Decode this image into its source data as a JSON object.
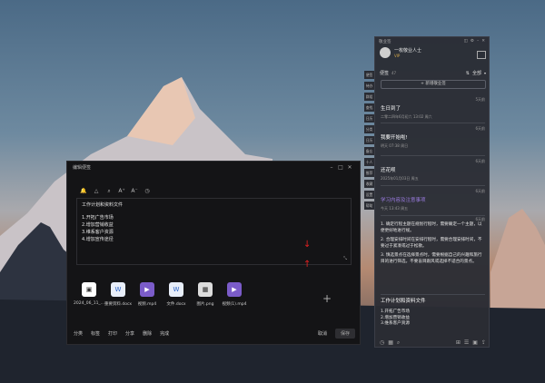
{
  "editor": {
    "title": "编辑便签",
    "toolbar_icons": [
      "bell-icon",
      "triangle-icon",
      "search-icon",
      "font-bigger-icon",
      "font-smaller-icon",
      "clock-icon"
    ],
    "content_lines": [
      "工作计划和资料文件",
      "1.开拓广告市场",
      "2.增加营销收益",
      "3.维系客户资源",
      "4.增加宣传途径"
    ],
    "attachments": [
      {
        "name": "2024_06_11_...",
        "type": "file",
        "icon": "file-icon"
      },
      {
        "name": "重要资料.docx",
        "type": "word",
        "icon": "word-icon"
      },
      {
        "name": "视频.mp4",
        "type": "video",
        "icon": "video-icon"
      },
      {
        "name": "文件.docx",
        "type": "word",
        "icon": "word-icon"
      },
      {
        "name": "图片.png",
        "type": "img",
        "icon": "image-icon"
      },
      {
        "name": "视频(1).mp4",
        "type": "video",
        "icon": "video-icon"
      }
    ],
    "bottom_actions": [
      "分类",
      "标签",
      "打印",
      "分享",
      "删除",
      "完成"
    ],
    "cancel_label": "取消",
    "save_label": "保存"
  },
  "panel": {
    "title": "敬业签",
    "username": "一枚敬业人士",
    "vip": "VIP",
    "tab": "便签",
    "tab_count": "47",
    "filter": "全部",
    "new_label": "+ 新增敬业签",
    "notes": [
      {
        "ago": "5天前",
        "title": "生日到了",
        "date": "二零二四年6月初六 13:02 周六"
      },
      {
        "ago": "6天前",
        "title": "我要开始啦!",
        "date": "明天 07:38 周日"
      },
      {
        "ago": "6天前",
        "title": "还花呗",
        "date": "2025年01月03日 周五"
      },
      {
        "ago": "6天前",
        "title": "学习内容及注意事项",
        "date": "今天 13:43 周五"
      }
    ],
    "long_note": {
      "ago": "6天前",
      "paragraphs": [
        "1. 确定行程主题在规划行程时，需要确定一个主题，以便更好地进行规。",
        "2. 合理安排时间在安排行程时，需要合理安排时间，不要过于紧凑或过于松散。",
        "3. 慎选景点在选择景点时，需要根据自己的兴趣和旅行目的进行筛选，不要盲目跟风或选择不适合的景点。"
      ]
    },
    "last_note": {
      "title": "工作计划和资料文件",
      "lines": [
        "1.开拓广告市场",
        "2.增加营销收益",
        "3.维系客户资源"
      ]
    }
  },
  "sidestrip": [
    "便签",
    "待办",
    "群组",
    "查找",
    "日历",
    "分类",
    "日历",
    "备忘",
    "十人",
    "推荐",
    "收藏",
    "设置",
    "帮助"
  ]
}
